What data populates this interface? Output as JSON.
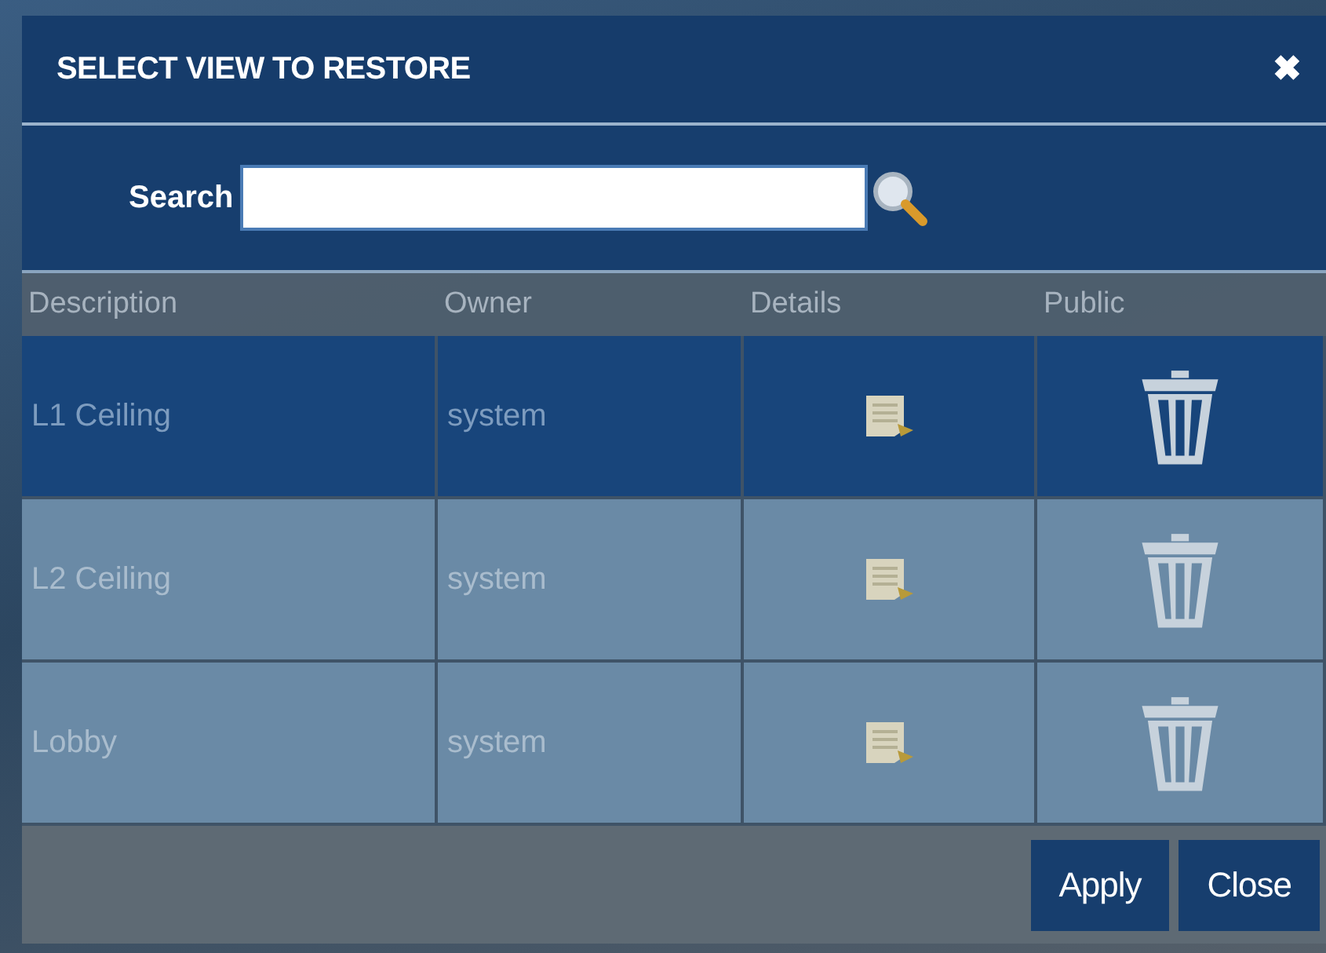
{
  "dialog": {
    "title": "SELECT VIEW TO RESTORE",
    "close_icon": "✖"
  },
  "search": {
    "label": "Search"
  },
  "table": {
    "columns": [
      "Description",
      "Owner",
      "Details",
      "Public"
    ],
    "rows": [
      {
        "description": "L1 Ceiling",
        "owner": "system",
        "selected": true
      },
      {
        "description": "L2 Ceiling",
        "owner": "system",
        "selected": false
      },
      {
        "description": "Lobby",
        "owner": "system",
        "selected": false
      }
    ]
  },
  "buttons": [
    "Apply",
    "Close"
  ]
}
